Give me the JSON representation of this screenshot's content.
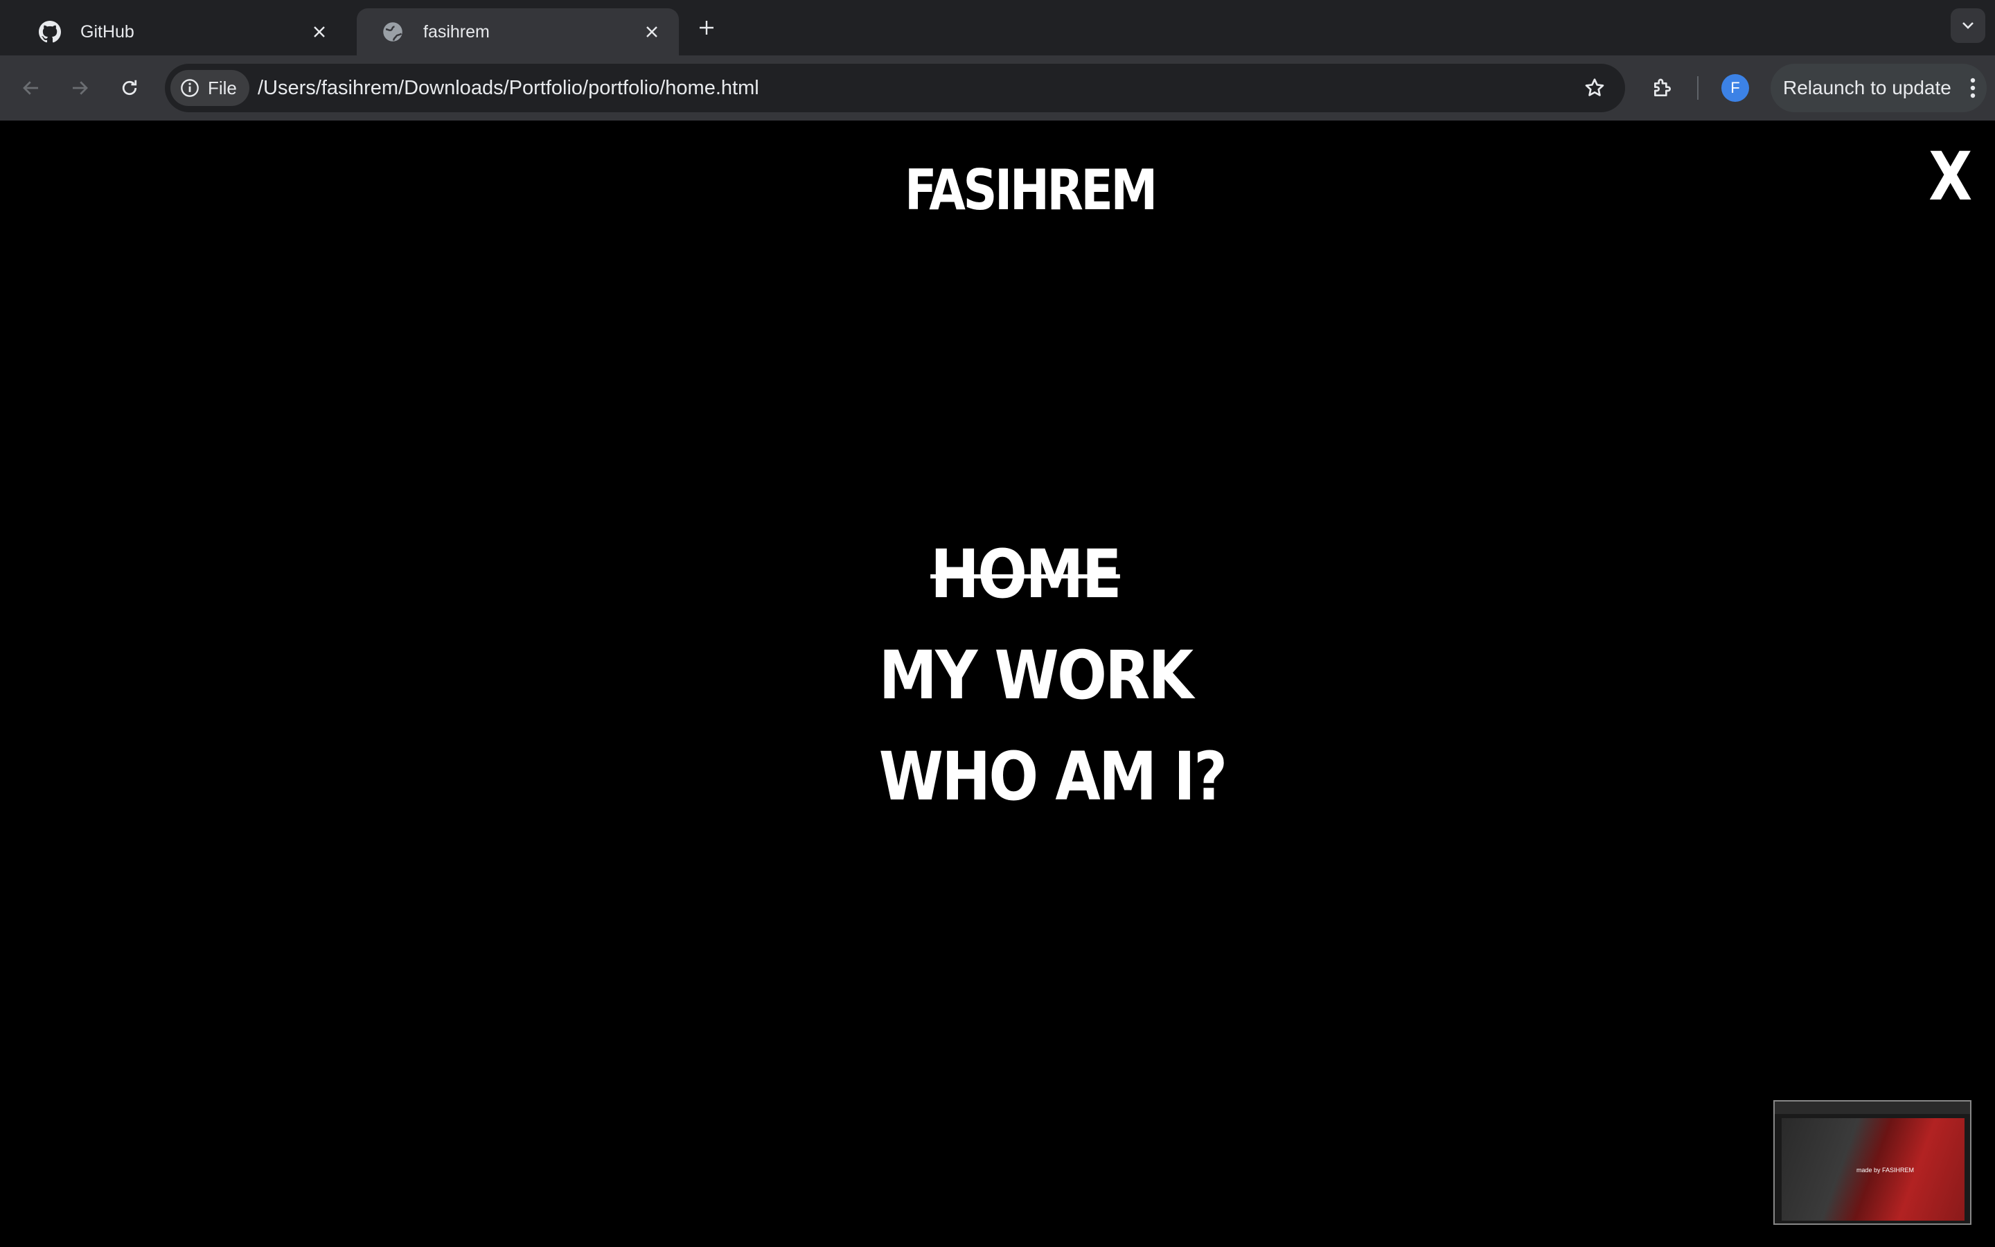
{
  "browser": {
    "tabs": [
      {
        "title": "GitHub",
        "icon": "github-icon",
        "active": false
      },
      {
        "title": "fasihrem",
        "icon": "globe-icon",
        "active": true
      }
    ],
    "omnibox": {
      "chip_label": "File",
      "url": "/Users/fasihrem/Downloads/Portfolio/portfolio/home.html"
    },
    "profile_initial": "F",
    "relaunch_label": "Relaunch to update"
  },
  "page": {
    "brand": "FASIHREM",
    "close_label": "X",
    "nav": [
      {
        "label": "HOME",
        "current": true
      },
      {
        "label": "MY WORK",
        "current": false
      },
      {
        "label": "WHO AM I?",
        "current": false
      }
    ],
    "thumbnail_caption": "made by FASIHREM"
  },
  "colors": {
    "page_background": "#000000",
    "text": "#ffffff",
    "chrome_tabbar": "#202124",
    "chrome_toolbar": "#35363a",
    "profile_accent": "#3c82e6"
  }
}
